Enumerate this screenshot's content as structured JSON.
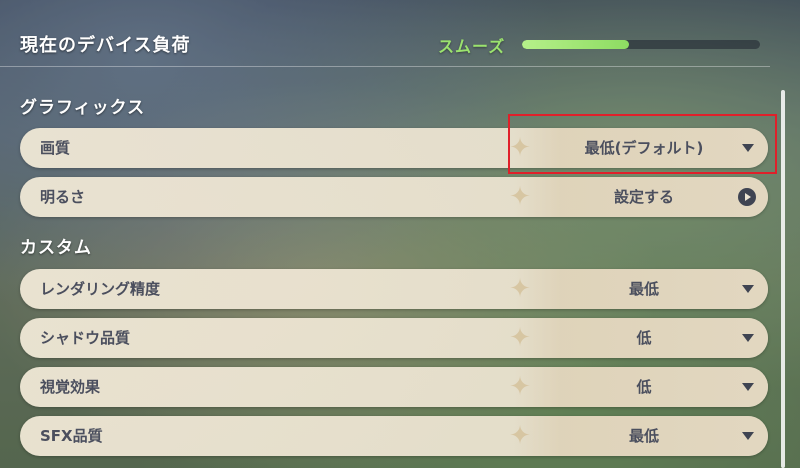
{
  "device_load": {
    "title": "現在のデバイス負荷",
    "status": "スムーズ",
    "status_color": "#9be36e",
    "bar_fill_percent": 45
  },
  "sections": {
    "graphics": "グラフィックス",
    "custom": "カスタム"
  },
  "rows": {
    "quality": {
      "label": "画質",
      "value": "最低(デフォルト)",
      "control": "dropdown"
    },
    "brightness": {
      "label": "明るさ",
      "value": "設定する",
      "control": "go"
    },
    "render_res": {
      "label": "レンダリング精度",
      "value": "最低",
      "control": "dropdown"
    },
    "shadow": {
      "label": "シャドウ品質",
      "value": "低",
      "control": "dropdown"
    },
    "visual_fx": {
      "label": "視覚効果",
      "value": "低",
      "control": "dropdown"
    },
    "sfx": {
      "label": "SFX品質",
      "value": "最低",
      "control": "dropdown"
    }
  },
  "highlight_color": "#e0202a",
  "icons": {
    "dropdown": "chevron-down-icon",
    "go": "arrow-right-circle-icon",
    "ornament": "star-ornament-icon"
  }
}
